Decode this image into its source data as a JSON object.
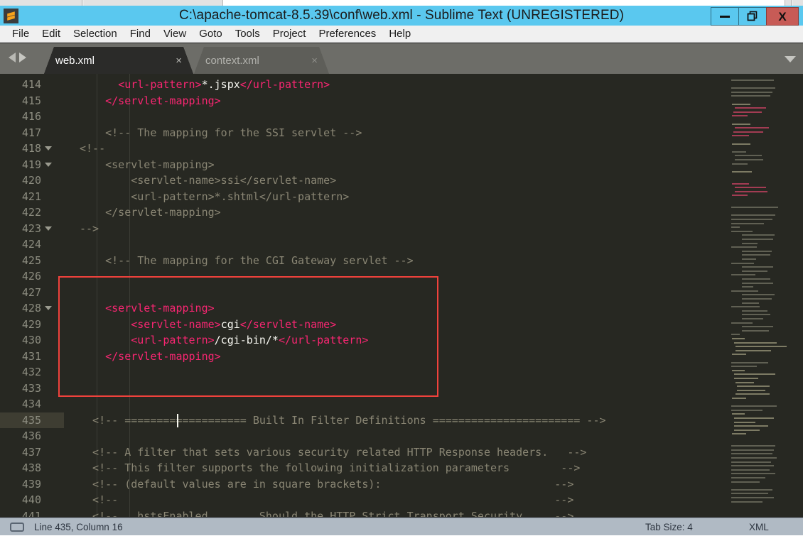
{
  "window": {
    "title": "C:\\apache-tomcat-8.5.39\\conf\\web.xml - Sublime Text (UNREGISTERED)",
    "app_icon": "sublime-text-icon",
    "controls": {
      "minimize": "–",
      "restore": "❐",
      "close": "X"
    },
    "titlebar_color": "#5ac8ef",
    "close_color": "#c75b56"
  },
  "menubar": {
    "items": [
      {
        "label": "File"
      },
      {
        "label": "Edit"
      },
      {
        "label": "Selection"
      },
      {
        "label": "Find"
      },
      {
        "label": "View"
      },
      {
        "label": "Goto"
      },
      {
        "label": "Tools"
      },
      {
        "label": "Project"
      },
      {
        "label": "Preferences"
      },
      {
        "label": "Help"
      }
    ]
  },
  "tabbar": {
    "nav_prev": "prev-tab-arrow",
    "nav_next": "next-tab-arrow",
    "overflow_menu": "tab-overflow-chevron",
    "close_glyph": "×",
    "tabs": [
      {
        "label": "web.xml",
        "active": true
      },
      {
        "label": "context.xml",
        "active": false
      }
    ]
  },
  "editor": {
    "background": "#272822",
    "active_line": 435,
    "annotation_box_color": "#f0423c",
    "first_line": 414,
    "lines": [
      {
        "n": 414,
        "fold": false,
        "tokens": [
          {
            "t": "      ",
            "c": "t-txt"
          },
          {
            "t": "<url-pattern>",
            "c": "t-tag"
          },
          {
            "t": "*.jspx",
            "c": "t-txt"
          },
          {
            "t": "</url-pattern>",
            "c": "t-tag"
          }
        ]
      },
      {
        "n": 415,
        "fold": false,
        "tokens": [
          {
            "t": "    ",
            "c": "t-txt"
          },
          {
            "t": "</servlet-mapping>",
            "c": "t-tag"
          }
        ]
      },
      {
        "n": 416,
        "fold": false,
        "tokens": []
      },
      {
        "n": 417,
        "fold": false,
        "tokens": [
          {
            "t": "    <!-- The mapping for the SSI servlet -->",
            "c": "t-cmt2"
          }
        ]
      },
      {
        "n": 418,
        "fold": true,
        "tokens": [
          {
            "t": "<!--",
            "c": "t-cmt2"
          }
        ]
      },
      {
        "n": 419,
        "fold": true,
        "tokens": [
          {
            "t": "    <servlet-mapping>",
            "c": "t-cmt2"
          }
        ]
      },
      {
        "n": 420,
        "fold": false,
        "tokens": [
          {
            "t": "        <servlet-name>ssi</servlet-name>",
            "c": "t-cmt2"
          }
        ]
      },
      {
        "n": 421,
        "fold": false,
        "tokens": [
          {
            "t": "        <url-pattern>*.shtml</url-pattern>",
            "c": "t-cmt2"
          }
        ]
      },
      {
        "n": 422,
        "fold": false,
        "tokens": [
          {
            "t": "    </servlet-mapping>",
            "c": "t-cmt2"
          }
        ]
      },
      {
        "n": 423,
        "fold": true,
        "tokens": [
          {
            "t": "-->",
            "c": "t-cmt2"
          }
        ]
      },
      {
        "n": 424,
        "fold": false,
        "tokens": []
      },
      {
        "n": 425,
        "fold": false,
        "tokens": [
          {
            "t": "    <!-- The mapping for the CGI Gateway servlet -->",
            "c": "t-cmt2"
          }
        ]
      },
      {
        "n": 426,
        "fold": false,
        "tokens": []
      },
      {
        "n": 427,
        "fold": false,
        "tokens": []
      },
      {
        "n": 428,
        "fold": true,
        "tokens": [
          {
            "t": "    ",
            "c": "t-txt"
          },
          {
            "t": "<servlet-mapping>",
            "c": "t-tag"
          }
        ]
      },
      {
        "n": 429,
        "fold": false,
        "tokens": [
          {
            "t": "        ",
            "c": "t-txt"
          },
          {
            "t": "<servlet-name>",
            "c": "t-tag"
          },
          {
            "t": "cgi",
            "c": "t-txt"
          },
          {
            "t": "</servlet-name>",
            "c": "t-tag"
          }
        ]
      },
      {
        "n": 430,
        "fold": false,
        "tokens": [
          {
            "t": "        ",
            "c": "t-txt"
          },
          {
            "t": "<url-pattern>",
            "c": "t-tag"
          },
          {
            "t": "/cgi-bin/*",
            "c": "t-txt"
          },
          {
            "t": "</url-pattern>",
            "c": "t-tag"
          }
        ]
      },
      {
        "n": 431,
        "fold": false,
        "tokens": [
          {
            "t": "    ",
            "c": "t-txt"
          },
          {
            "t": "</servlet-mapping>",
            "c": "t-tag"
          }
        ]
      },
      {
        "n": 432,
        "fold": false,
        "tokens": []
      },
      {
        "n": 433,
        "fold": false,
        "tokens": []
      },
      {
        "n": 434,
        "fold": false,
        "tokens": []
      },
      {
        "n": 435,
        "fold": false,
        "tokens": [
          {
            "t": "  <!-- =================== Built In Filter Definitions ======================= -->",
            "c": "t-cmt2"
          }
        ]
      },
      {
        "n": 436,
        "fold": false,
        "tokens": []
      },
      {
        "n": 437,
        "fold": false,
        "tokens": [
          {
            "t": "  <!-- A filter that sets various security related HTTP Response headers.   -->",
            "c": "t-cmt2"
          }
        ]
      },
      {
        "n": 438,
        "fold": false,
        "tokens": [
          {
            "t": "  <!-- This filter supports the following initialization parameters        -->",
            "c": "t-cmt2"
          }
        ]
      },
      {
        "n": 439,
        "fold": false,
        "tokens": [
          {
            "t": "  <!-- (default values are in square brackets):                           -->",
            "c": "t-cmt2"
          }
        ]
      },
      {
        "n": 440,
        "fold": false,
        "tokens": [
          {
            "t": "  <!--                                                                    -->",
            "c": "t-cmt2"
          }
        ]
      },
      {
        "n": 441,
        "fold": false,
        "tokens": [
          {
            "t": "  <!--   hstsEnabled        Should the HTTP Strict Transport Security     -->",
            "c": "t-cmt2"
          }
        ]
      }
    ]
  },
  "statusbar": {
    "sidebar_icon": "sidebar-toggle-icon",
    "position": "Line 435, Column 16",
    "tab_size": "Tab Size: 4",
    "syntax": "XML"
  }
}
